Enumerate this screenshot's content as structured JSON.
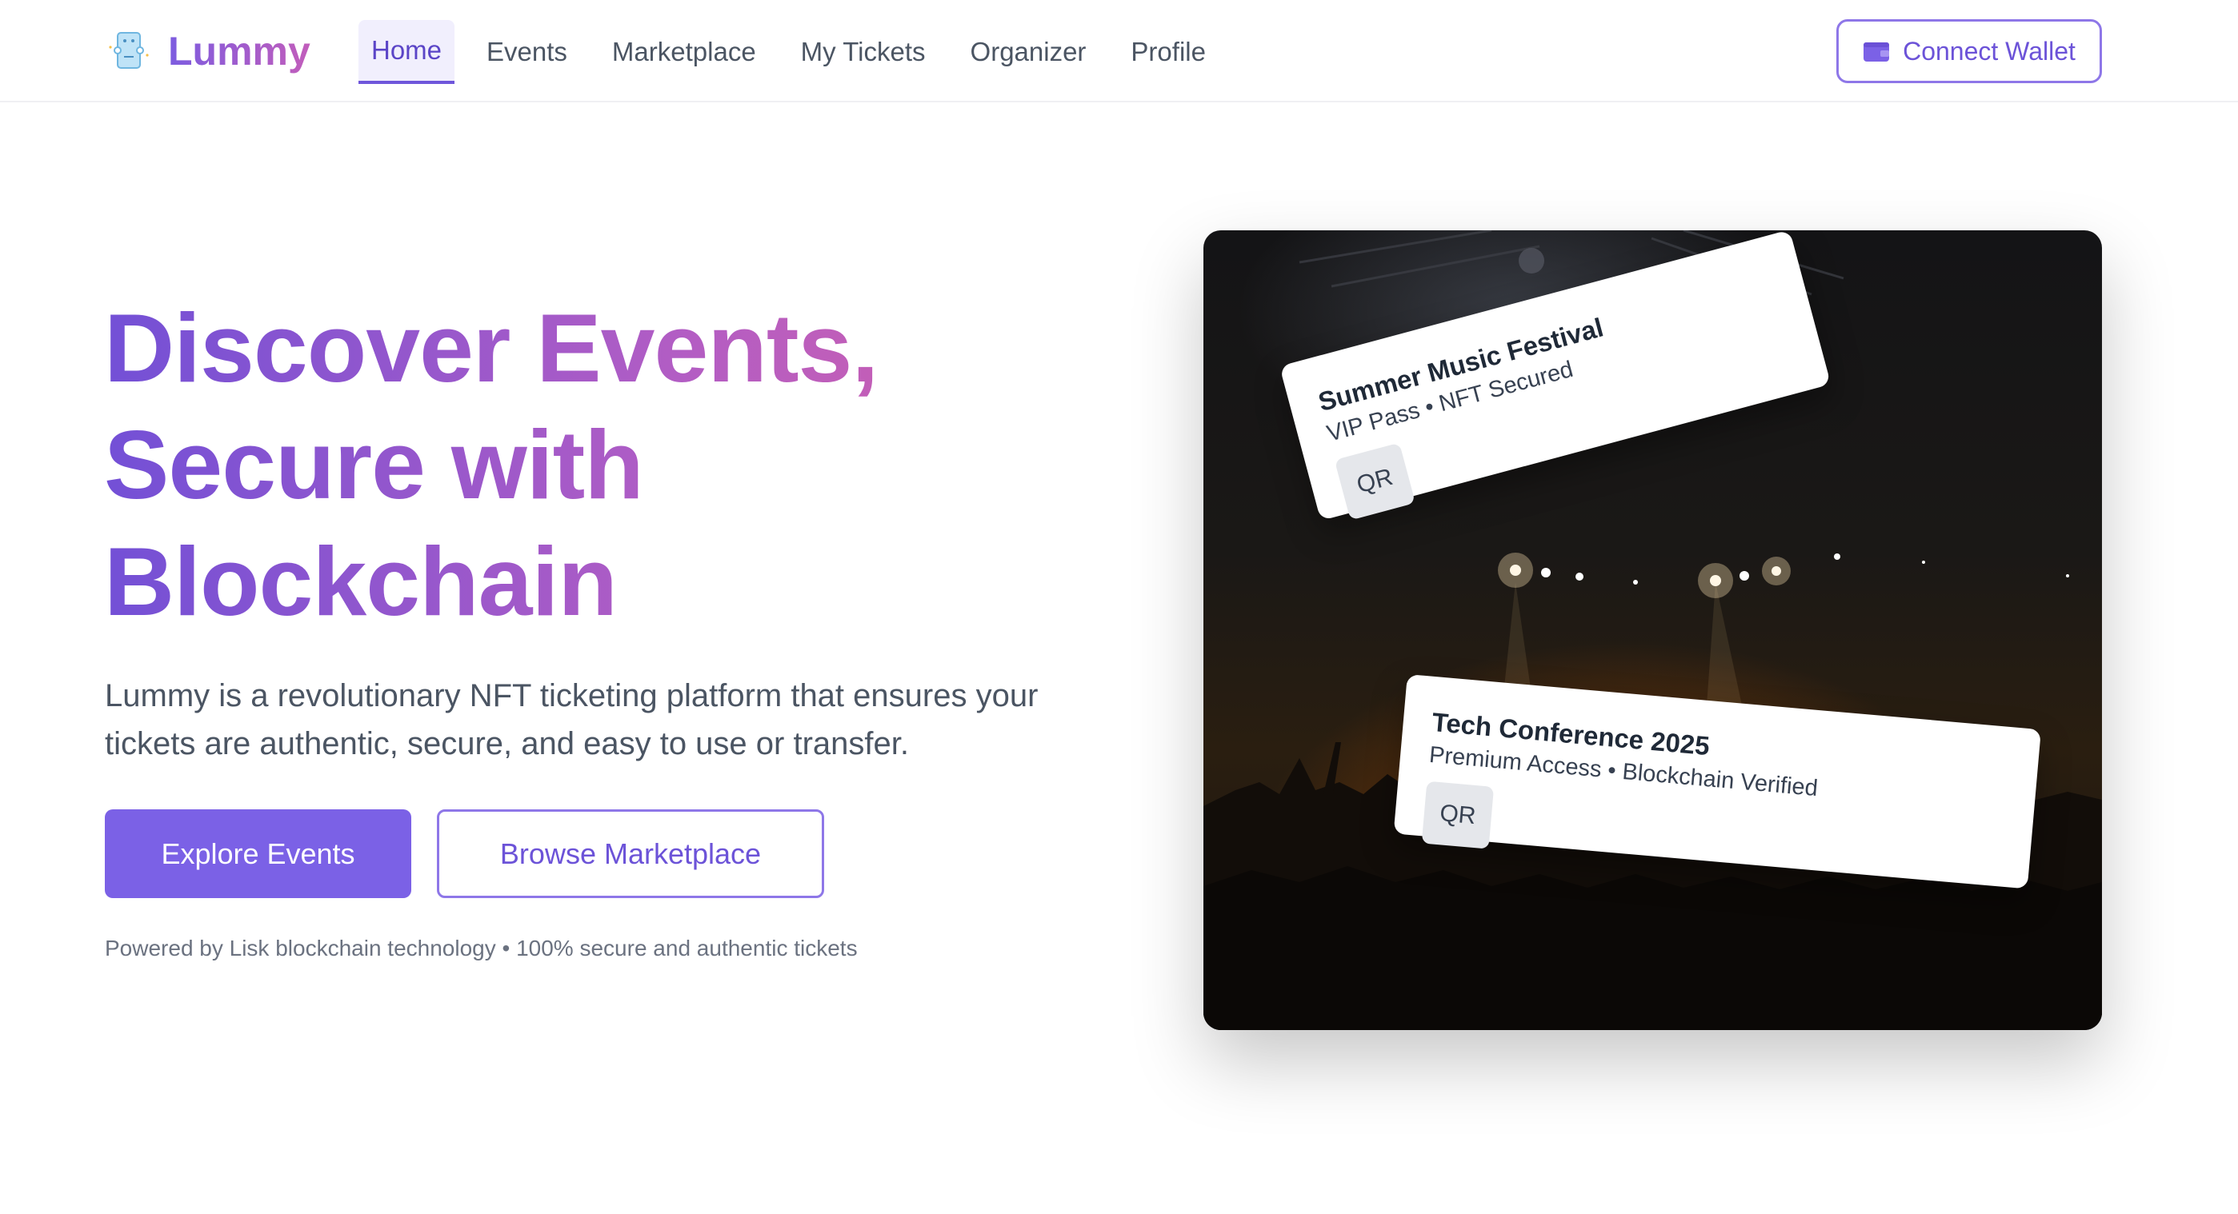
{
  "brand": {
    "name": "Lummy",
    "icon": "ticket-icon",
    "gradient_start": "#7c5ce0",
    "gradient_end": "#c25dbb"
  },
  "nav": {
    "items": [
      {
        "label": "Home",
        "active": true
      },
      {
        "label": "Events",
        "active": false
      },
      {
        "label": "Marketplace",
        "active": false
      },
      {
        "label": "My Tickets",
        "active": false
      },
      {
        "label": "Organizer",
        "active": false
      },
      {
        "label": "Profile",
        "active": false
      }
    ]
  },
  "header": {
    "wallet_button": "Connect Wallet",
    "wallet_icon": "wallet-icon"
  },
  "hero": {
    "title_line1": "Discover Events,",
    "title_line2": "Secure with",
    "title_line3": "Blockchain",
    "description_line1": "Lummy is a revolutionary NFT ticketing platform that ensures your",
    "description_line2": "tickets are authentic, secure, and easy to use or transfer.",
    "primary_button": "Explore Events",
    "secondary_button": "Browse Marketplace",
    "powered_by": "Powered by Lisk blockchain technology • 100% secure and authentic tickets"
  },
  "tickets": [
    {
      "title": "Summer Music Festival",
      "subtitle": "VIP Pass • NFT Secured",
      "qr": "QR"
    },
    {
      "title": "Tech Conference 2025",
      "subtitle": "Premium Access • Blockchain Verified",
      "qr": "QR"
    }
  ],
  "colors": {
    "accent": "#7b61e6",
    "accent_text": "#6c53d8",
    "text_muted": "#6b7280"
  }
}
